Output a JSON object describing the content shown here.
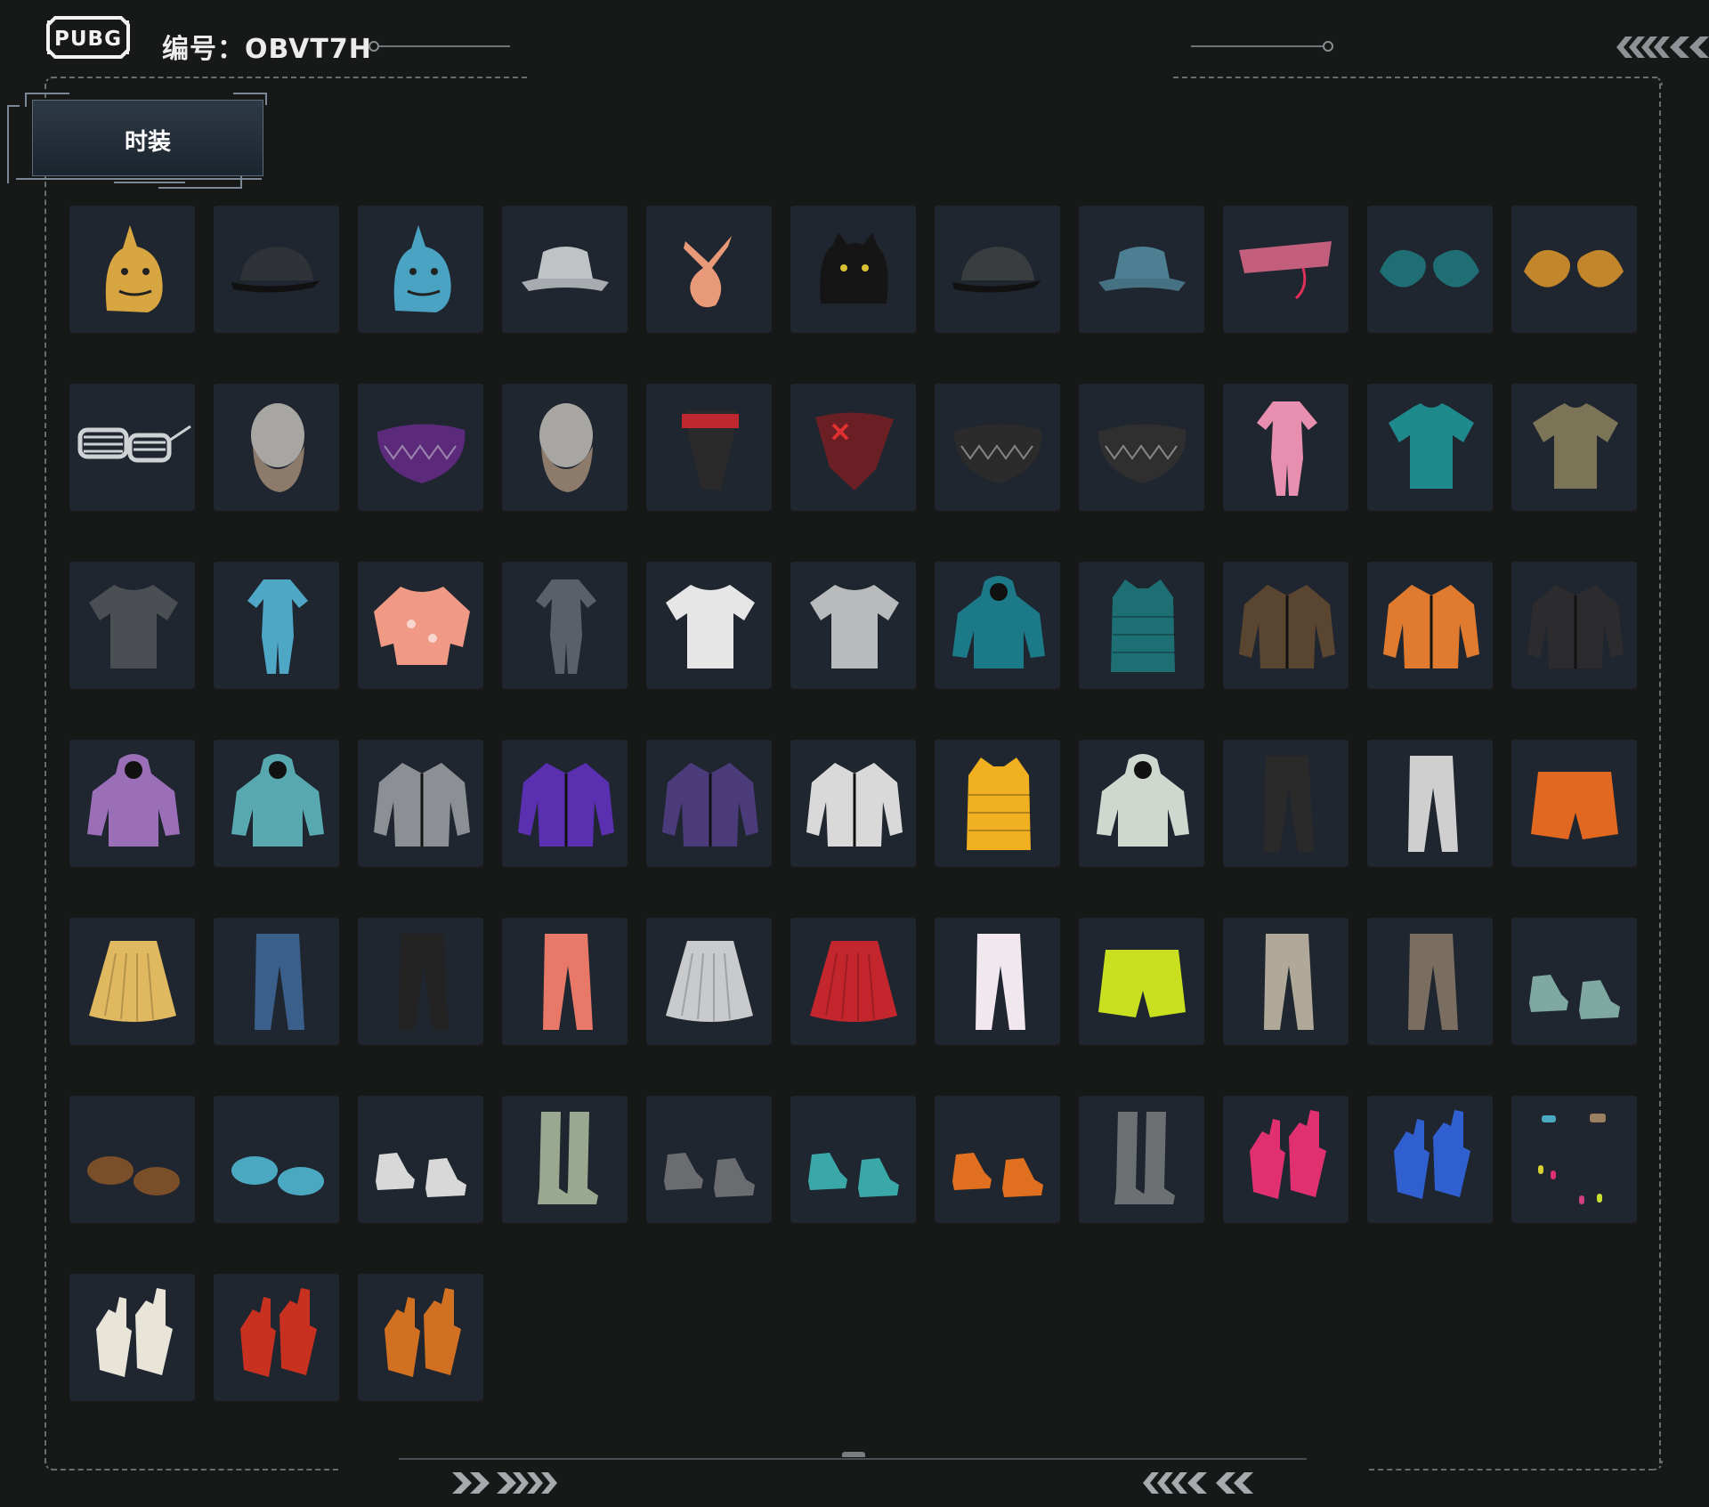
{
  "header": {
    "logo_text": "PUBG",
    "code_label": "编号：OBVT7H"
  },
  "tab": {
    "label": "时装"
  },
  "colors": {
    "background": "#171818",
    "cell": "#1f2630",
    "accent_line": "#6f7276"
  },
  "items": [
    {
      "name": "yellow dinosaur head mask",
      "icon": "dino-mask-icon"
    },
    {
      "name": "black baseball cap",
      "icon": "cap-icon"
    },
    {
      "name": "blue dinosaur head mask",
      "icon": "dino-mask-icon"
    },
    {
      "name": "grey bucket hat",
      "icon": "bucket-hat-icon"
    },
    {
      "name": "pink bandana headband",
      "icon": "headband-icon"
    },
    {
      "name": "black cat ear hat",
      "icon": "cat-hat-icon"
    },
    {
      "name": "black patterned cap",
      "icon": "cap-icon"
    },
    {
      "name": "denim bucket hat",
      "icon": "bucket-hat-icon"
    },
    {
      "name": "pink visor glasses",
      "icon": "visor-icon"
    },
    {
      "name": "teal cat-eye goggles",
      "icon": "goggles-icon"
    },
    {
      "name": "amber cat-eye goggles",
      "icon": "goggles-icon"
    },
    {
      "name": "shutter shades",
      "icon": "sunglasses-icon"
    },
    {
      "name": "full beard",
      "icon": "beard-icon"
    },
    {
      "name": "purple neon mask",
      "icon": "face-mask-icon"
    },
    {
      "name": "goatee",
      "icon": "beard-icon"
    },
    {
      "name": "red cyber helmet mask",
      "icon": "helmet-mask-icon"
    },
    {
      "name": "red black bandana mask",
      "icon": "bandana-mask-icon"
    },
    {
      "name": "black face mask",
      "icon": "face-mask-icon"
    },
    {
      "name": "shark teeth face mask",
      "icon": "face-mask-icon"
    },
    {
      "name": "pink jumpsuit",
      "icon": "jumpsuit-icon"
    },
    {
      "name": "teal polo shirt",
      "icon": "shirt-icon"
    },
    {
      "name": "khaki tactical shirt",
      "icon": "shirt-icon"
    },
    {
      "name": "land loot survive t-shirt",
      "icon": "tshirt-icon"
    },
    {
      "name": "blue onesie",
      "icon": "jumpsuit-icon"
    },
    {
      "name": "peach bunny sweater",
      "icon": "sweater-icon"
    },
    {
      "name": "grey work coveralls",
      "icon": "jumpsuit-icon"
    },
    {
      "name": "white t-shirt",
      "icon": "tshirt-icon"
    },
    {
      "name": "light grey t-shirt",
      "icon": "tshirt-icon"
    },
    {
      "name": "teal hoodie",
      "icon": "hoodie-icon"
    },
    {
      "name": "teal puffer vest",
      "icon": "vest-icon"
    },
    {
      "name": "black gold patterned jacket",
      "icon": "jacket-icon"
    },
    {
      "name": "orange neon jacket",
      "icon": "jacket-icon"
    },
    {
      "name": "black leather jacket",
      "icon": "jacket-icon"
    },
    {
      "name": "graffiti hoodie",
      "icon": "hoodie-icon"
    },
    {
      "name": "duck teal hoodie",
      "icon": "hoodie-icon"
    },
    {
      "name": "grey orange bomber jacket",
      "icon": "jacket-icon"
    },
    {
      "name": "purple racing jacket",
      "icon": "jacket-icon"
    },
    {
      "name": "purple camo jacket",
      "icon": "jacket-icon"
    },
    {
      "name": "white orange tech jacket",
      "icon": "jacket-icon"
    },
    {
      "name": "yellow puffer vest",
      "icon": "vest-icon"
    },
    {
      "name": "white leaf hoodie",
      "icon": "hoodie-icon"
    },
    {
      "name": "black joggers",
      "icon": "pants-icon"
    },
    {
      "name": "grey joggers",
      "icon": "pants-icon"
    },
    {
      "name": "orange shorts",
      "icon": "shorts-icon"
    },
    {
      "name": "yellow pleated skirt",
      "icon": "skirt-icon"
    },
    {
      "name": "blue jeans",
      "icon": "pants-icon"
    },
    {
      "name": "black tactical pants",
      "icon": "pants-icon"
    },
    {
      "name": "bunny print pants",
      "icon": "pants-icon"
    },
    {
      "name": "silver skirt",
      "icon": "skirt-icon"
    },
    {
      "name": "red pleated skirt",
      "icon": "skirt-icon"
    },
    {
      "name": "white pink pants",
      "icon": "pants-icon"
    },
    {
      "name": "neon yellow shorts",
      "icon": "shorts-icon"
    },
    {
      "name": "khaki cargo pants",
      "icon": "pants-icon"
    },
    {
      "name": "brown cargo pants",
      "icon": "pants-icon"
    },
    {
      "name": "patterned sneakers",
      "icon": "shoes-icon"
    },
    {
      "name": "bear paw shoes",
      "icon": "paw-shoes-icon"
    },
    {
      "name": "blue paw shoes",
      "icon": "paw-shoes-icon"
    },
    {
      "name": "white sneakers",
      "icon": "shoes-icon"
    },
    {
      "name": "green thigh boots",
      "icon": "boots-icon"
    },
    {
      "name": "grey high-top shoes",
      "icon": "shoes-icon"
    },
    {
      "name": "teal clogs",
      "icon": "shoes-icon"
    },
    {
      "name": "orange sneakers",
      "icon": "shoes-icon"
    },
    {
      "name": "camo boots",
      "icon": "boots-icon"
    },
    {
      "name": "pink gloves",
      "icon": "gloves-icon"
    },
    {
      "name": "blue gloves",
      "icon": "gloves-icon"
    },
    {
      "name": "nail accessories",
      "icon": "nails-icon"
    },
    {
      "name": "white gold gloves",
      "icon": "gloves-icon"
    },
    {
      "name": "red black gloves",
      "icon": "gloves-icon"
    },
    {
      "name": "orange black gloves",
      "icon": "gloves-icon"
    }
  ]
}
